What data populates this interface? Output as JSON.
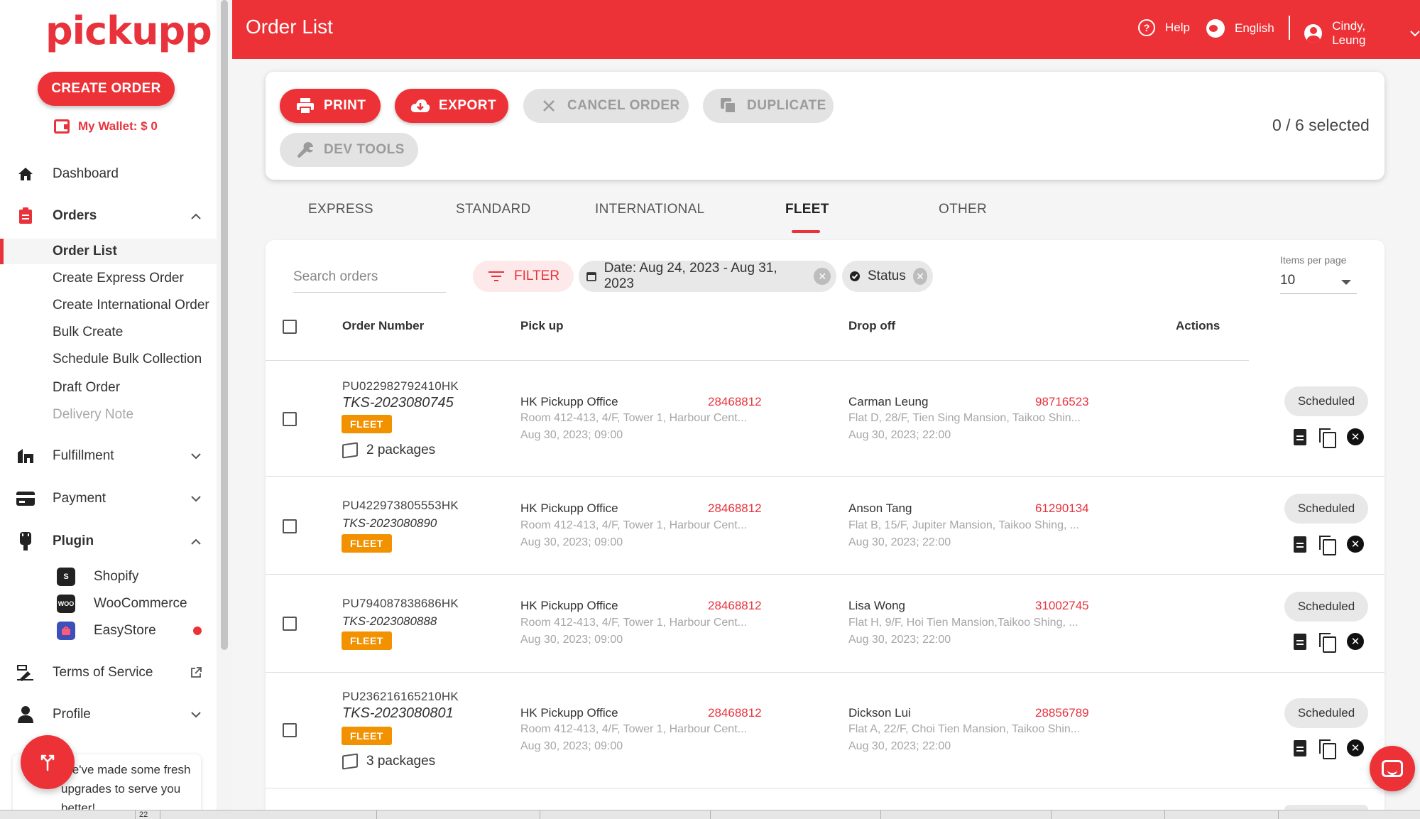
{
  "brand": {
    "logo_text": "pickupp",
    "accent": "#ed3237"
  },
  "sidebar": {
    "create_order_label": "CREATE ORDER",
    "wallet_label": "My Wallet: $ 0",
    "dashboard": "Dashboard",
    "orders": "Orders",
    "orders_sub": [
      "Order List",
      "Create Express Order",
      "Create International Order",
      "Bulk Create",
      "Schedule Bulk Collection",
      "Draft Order",
      "Delivery Note"
    ],
    "fulfillment": "Fulfillment",
    "payment": "Payment",
    "plugin": "Plugin",
    "plugins": [
      {
        "label": "Shopify",
        "icon": "shopify-icon",
        "badge": ""
      },
      {
        "label": "WooCommerce",
        "icon": "woocommerce-icon",
        "badge": "WOO"
      },
      {
        "label": "EasyStore",
        "icon": "easystore-icon",
        "badge": ""
      }
    ],
    "terms": "Terms of Service",
    "profile": "Profile",
    "promo_text": "We've made some fresh upgrades to serve you better!"
  },
  "header": {
    "title": "Order List",
    "help": "Help",
    "language": "English",
    "user": "Cindy, Leung"
  },
  "actions": {
    "print": "PRINT",
    "export": "EXPORT",
    "cancel": "CANCEL ORDER",
    "duplicate": "DUPLICATE",
    "dev_tools": "DEV TOOLS",
    "selected": "0 / 6 selected"
  },
  "tabs": [
    "EXPRESS",
    "STANDARD",
    "INTERNATIONAL",
    "FLEET",
    "OTHER"
  ],
  "active_tab": "FLEET",
  "filters": {
    "search_placeholder": "Search orders",
    "filter_label": "FILTER",
    "date_chip": "Date: Aug 24, 2023 - Aug 31, 2023",
    "status_chip": "Status",
    "items_per_page_label": "Items per page",
    "items_per_page_value": "10"
  },
  "table": {
    "headers": {
      "order_number": "Order Number",
      "pickup": "Pick up",
      "dropoff": "Drop off",
      "actions": "Actions"
    },
    "rows": [
      {
        "order_no": "PU022982792410HK",
        "ref": "TKS-2023080745",
        "badge": "FLEET",
        "packages": "2 packages",
        "pickup_name": "HK Pickupp Office",
        "pickup_phone": "28468812",
        "pickup_addr": "Room 412-413, 4/F, Tower 1, Harbour Cent...",
        "pickup_time": "Aug 30, 2023; 09:00",
        "drop_name": "Carman Leung",
        "drop_phone": "98716523",
        "drop_addr": "Flat D, 28/F, Tien Sing Mansion, Taikoo Shin...",
        "drop_time": "Aug 30, 2023; 22:00",
        "status": "Scheduled"
      },
      {
        "order_no": "PU422973805553HK",
        "ref": "TKS-2023080890",
        "badge": "FLEET",
        "packages": "",
        "pickup_name": "HK Pickupp Office",
        "pickup_phone": "28468812",
        "pickup_addr": "Room 412-413, 4/F, Tower 1, Harbour Cent...",
        "pickup_time": "Aug 30, 2023; 09:00",
        "drop_name": "Anson Tang",
        "drop_phone": "61290134",
        "drop_addr": "Flat B, 15/F, Jupiter Mansion, Taikoo Shing, ...",
        "drop_time": "Aug 30, 2023; 22:00",
        "status": "Scheduled"
      },
      {
        "order_no": "PU794087838686HK",
        "ref": "TKS-2023080888",
        "badge": "FLEET",
        "packages": "",
        "pickup_name": "HK Pickupp Office",
        "pickup_phone": "28468812",
        "pickup_addr": "Room 412-413, 4/F, Tower 1, Harbour Cent...",
        "pickup_time": "Aug 30, 2023; 09:00",
        "drop_name": "Lisa Wong",
        "drop_phone": "31002745",
        "drop_addr": "Flat H, 9/F, Hoi Tien Mansion,Taikoo Shing, ...",
        "drop_time": "Aug 30, 2023; 22:00",
        "status": "Scheduled"
      },
      {
        "order_no": "PU236216165210HK",
        "ref": "TKS-2023080801",
        "badge": "FLEET",
        "packages": "3 packages",
        "pickup_name": "HK Pickupp Office",
        "pickup_phone": "28468812",
        "pickup_addr": "Room 412-413, 4/F, Tower 1, Harbour Cent...",
        "pickup_time": "Aug 30, 2023; 09:00",
        "drop_name": "Dickson Lui",
        "drop_phone": "28856789",
        "drop_addr": "Flat A, 22/F, Choi Tien Mansion, Taikoo Shin...",
        "drop_time": "Aug 30, 2023; 22:00",
        "status": "Scheduled"
      }
    ]
  },
  "footer_strip": {
    "number": "22"
  }
}
